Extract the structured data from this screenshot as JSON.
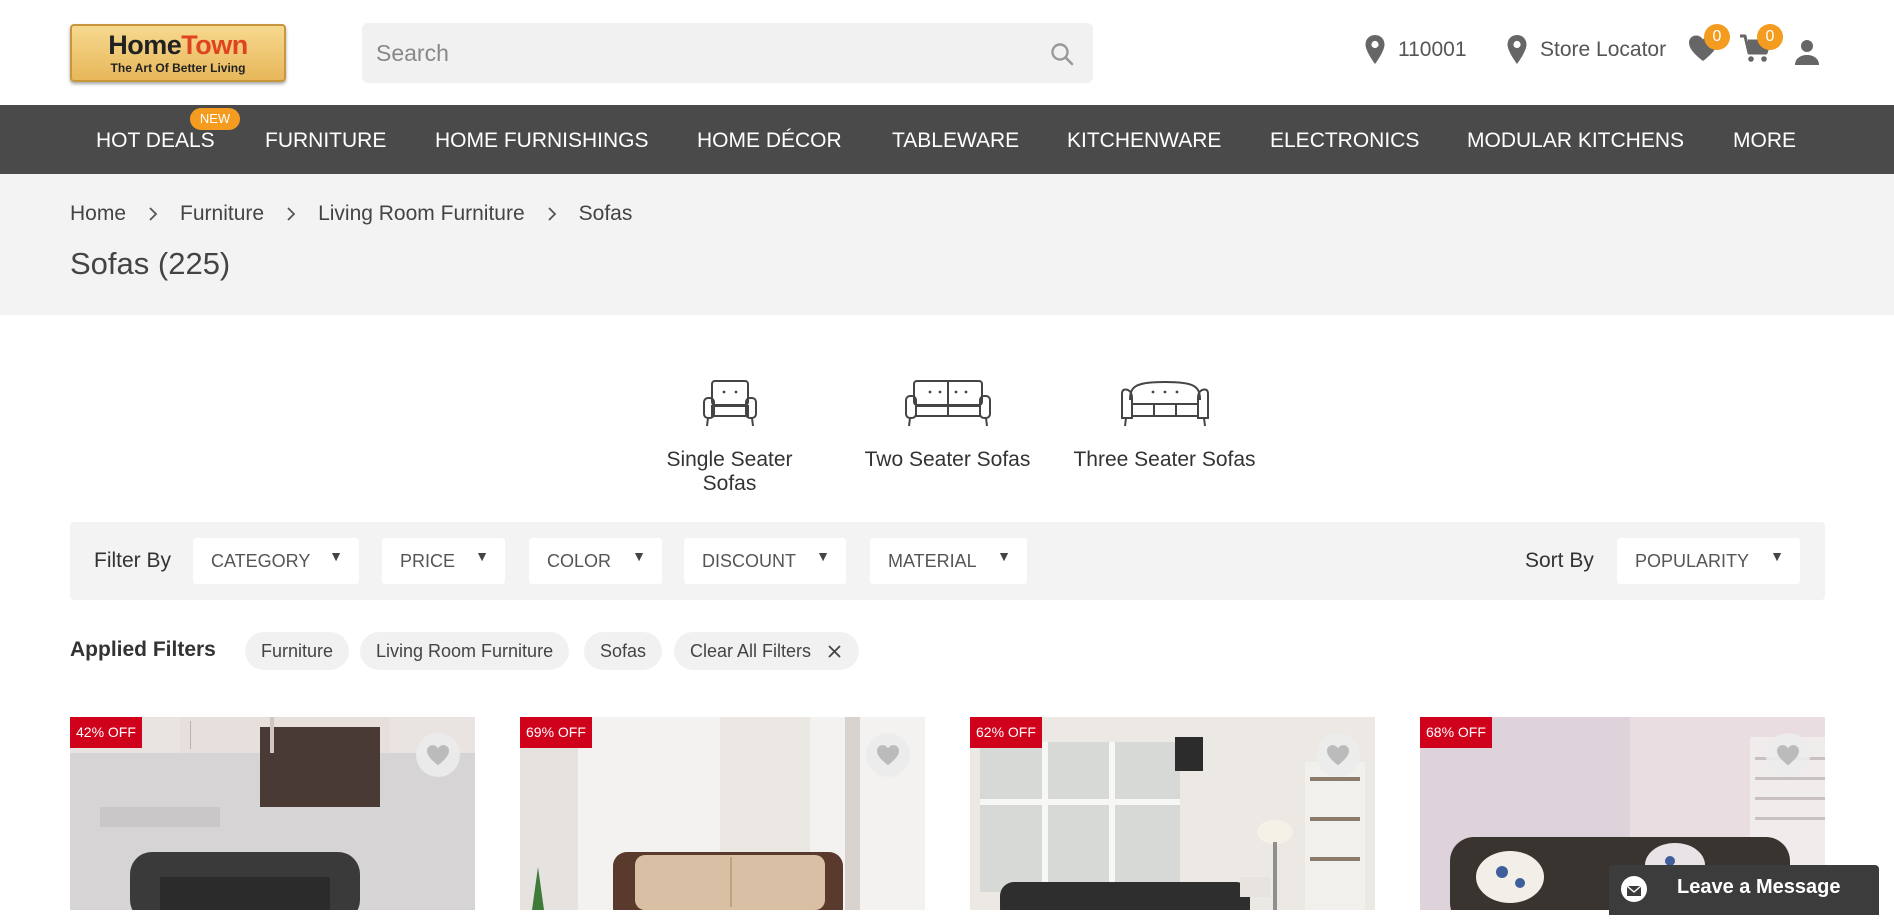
{
  "header": {
    "logo": {
      "line1_a": "Home",
      "line1_b": "Town",
      "tagline": "The Art Of Better Living"
    },
    "search_placeholder": "Search",
    "pincode": "110001",
    "store_locator": "Store Locator",
    "wishlist_count": "0",
    "cart_count": "0"
  },
  "nav": {
    "items": [
      "HOT DEALS",
      "FURNITURE",
      "HOME FURNISHINGS",
      "HOME DÉCOR",
      "TABLEWARE",
      "KITCHENWARE",
      "ELECTRONICS",
      "MODULAR KITCHENS",
      "MORE"
    ],
    "new_badge": "NEW"
  },
  "breadcrumb": [
    "Home",
    "Furniture",
    "Living Room Furniture",
    "Sofas"
  ],
  "page_title": "Sofas (225)",
  "categories": [
    "Single Seater Sofas",
    "Two Seater Sofas",
    "Three Seater Sofas"
  ],
  "filters": {
    "label": "Filter By",
    "options": [
      "CATEGORY",
      "PRICE",
      "COLOR",
      "DISCOUNT",
      "MATERIAL"
    ],
    "sort_label": "Sort By",
    "sort_value": "POPULARITY"
  },
  "applied": {
    "label": "Applied Filters",
    "chips": [
      "Furniture",
      "Living Room Furniture",
      "Sofas"
    ],
    "clear": "Clear All Filters"
  },
  "products": [
    {
      "discount": "42% OFF"
    },
    {
      "discount": "69% OFF"
    },
    {
      "discount": "62% OFF"
    },
    {
      "discount": "68% OFF"
    }
  ],
  "chat": {
    "label": "Leave a Message"
  },
  "colors": {
    "nav_bg": "#4a4a4a",
    "accent": "#f39c1f",
    "discount": "#d0021b"
  }
}
